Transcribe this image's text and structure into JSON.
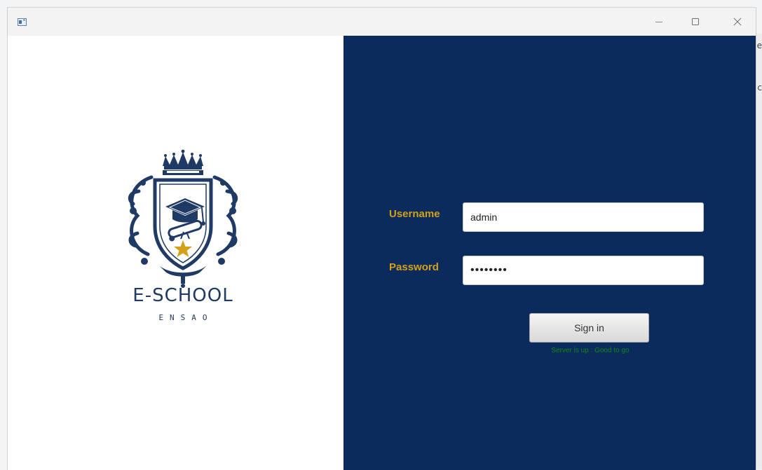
{
  "window": {
    "minimize_glyph": "—",
    "maximize_glyph": "☐",
    "close_glyph": "✕"
  },
  "branding": {
    "name": "E-SCHOOL",
    "subtitle": "ENSAO"
  },
  "login": {
    "username_label": "Username",
    "username_value": "admin",
    "password_label": "Password",
    "password_value": "••••••••",
    "signin_label": "Sign in",
    "status": "Server is up : Good to go"
  },
  "colors": {
    "panel_bg": "#0b2b5c",
    "label_gold": "#d4a017",
    "status_green": "#0e8a0e",
    "crest_navy": "#1f3a64",
    "star_gold": "#d4a017"
  },
  "background_glyphs": [
    "e",
    "c"
  ],
  "icons": [
    "app-icon",
    "minimize-icon",
    "maximize-icon",
    "close-icon",
    "crest-logo",
    "crown-icon",
    "graduation-cap-icon",
    "diploma-icon",
    "star-icon"
  ]
}
